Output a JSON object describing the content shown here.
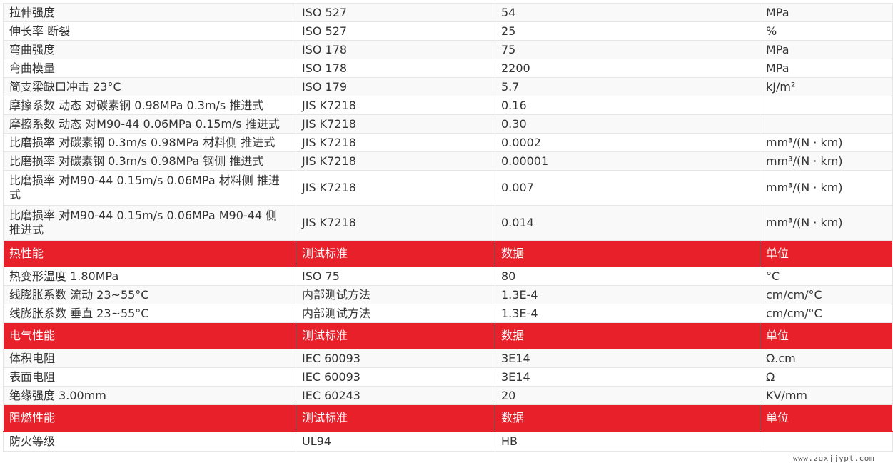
{
  "accent_color": "#e8202a",
  "rows": [
    {
      "kind": "data",
      "cells": [
        "拉伸强度",
        "ISO 527",
        "54",
        "MPa"
      ]
    },
    {
      "kind": "data",
      "cells": [
        "伸长率  断裂",
        "ISO 527",
        "25",
        "%"
      ]
    },
    {
      "kind": "data",
      "cells": [
        "弯曲强度",
        "ISO 178",
        "75",
        "MPa"
      ]
    },
    {
      "kind": "data",
      "cells": [
        "弯曲模量",
        "ISO 178",
        "2200",
        "MPa"
      ]
    },
    {
      "kind": "data",
      "cells": [
        "简支梁缺口冲击  23°C",
        "ISO 179",
        "5.7",
        "kJ/m²"
      ]
    },
    {
      "kind": "data",
      "cells": [
        "摩擦系数  动态 对碳素钢 0.98MPa 0.3m/s 推进式",
        "JIS K7218",
        "0.16",
        ""
      ]
    },
    {
      "kind": "data",
      "cells": [
        "摩擦系数  动态 对M90-44 0.06MPa 0.15m/s 推进式",
        "JIS K7218",
        "0.30",
        ""
      ]
    },
    {
      "kind": "data",
      "cells": [
        "比磨损率  对碳素钢 0.3m/s 0.98MPa 材料侧 推进式",
        "JIS K7218",
        "0.0002",
        "mm³/(N · km)"
      ]
    },
    {
      "kind": "data",
      "cells": [
        "比磨损率  对碳素钢 0.3m/s 0.98MPa 钢侧 推进式",
        "JIS K7218",
        "0.00001",
        "mm³/(N · km)"
      ]
    },
    {
      "kind": "data",
      "cells": [
        "比磨损率  对M90-44 0.15m/s 0.06MPa 材料侧 推进式",
        "JIS K7218",
        "0.007",
        "mm³/(N · km)"
      ]
    },
    {
      "kind": "data",
      "cells": [
        "比磨损率  对M90-44 0.15m/s 0.06MPa M90-44 侧 推进式",
        "JIS K7218",
        "0.014",
        "mm³/(N · km)"
      ]
    },
    {
      "kind": "header",
      "cells": [
        "热性能",
        "测试标准",
        "数据",
        "单位"
      ]
    },
    {
      "kind": "data",
      "cells": [
        "热变形温度  1.80MPa",
        "ISO 75",
        "80",
        "°C"
      ]
    },
    {
      "kind": "data",
      "cells": [
        "线膨胀系数  流动 23~55°C",
        "内部测试方法",
        "1.3E-4",
        "cm/cm/°C"
      ]
    },
    {
      "kind": "data",
      "cells": [
        "线膨胀系数  垂直 23~55°C",
        "内部测试方法",
        "1.3E-4",
        "cm/cm/°C"
      ]
    },
    {
      "kind": "header",
      "cells": [
        "电气性能",
        "测试标准",
        "数据",
        "单位"
      ]
    },
    {
      "kind": "data",
      "cells": [
        "体积电阻",
        "IEC 60093",
        "3E14",
        "Ω.cm"
      ]
    },
    {
      "kind": "data",
      "cells": [
        "表面电阻",
        "IEC 60093",
        "3E14",
        "Ω"
      ]
    },
    {
      "kind": "data",
      "cells": [
        "绝缘强度  3.00mm",
        "IEC 60243",
        "20",
        "KV/mm"
      ]
    },
    {
      "kind": "header",
      "cells": [
        "阻燃性能",
        "测试标准",
        "数据",
        "单位"
      ]
    },
    {
      "kind": "data",
      "cells": [
        "防火等级",
        "UL94",
        "HB",
        ""
      ]
    }
  ],
  "watermark": "www.zgxjjypt.com"
}
